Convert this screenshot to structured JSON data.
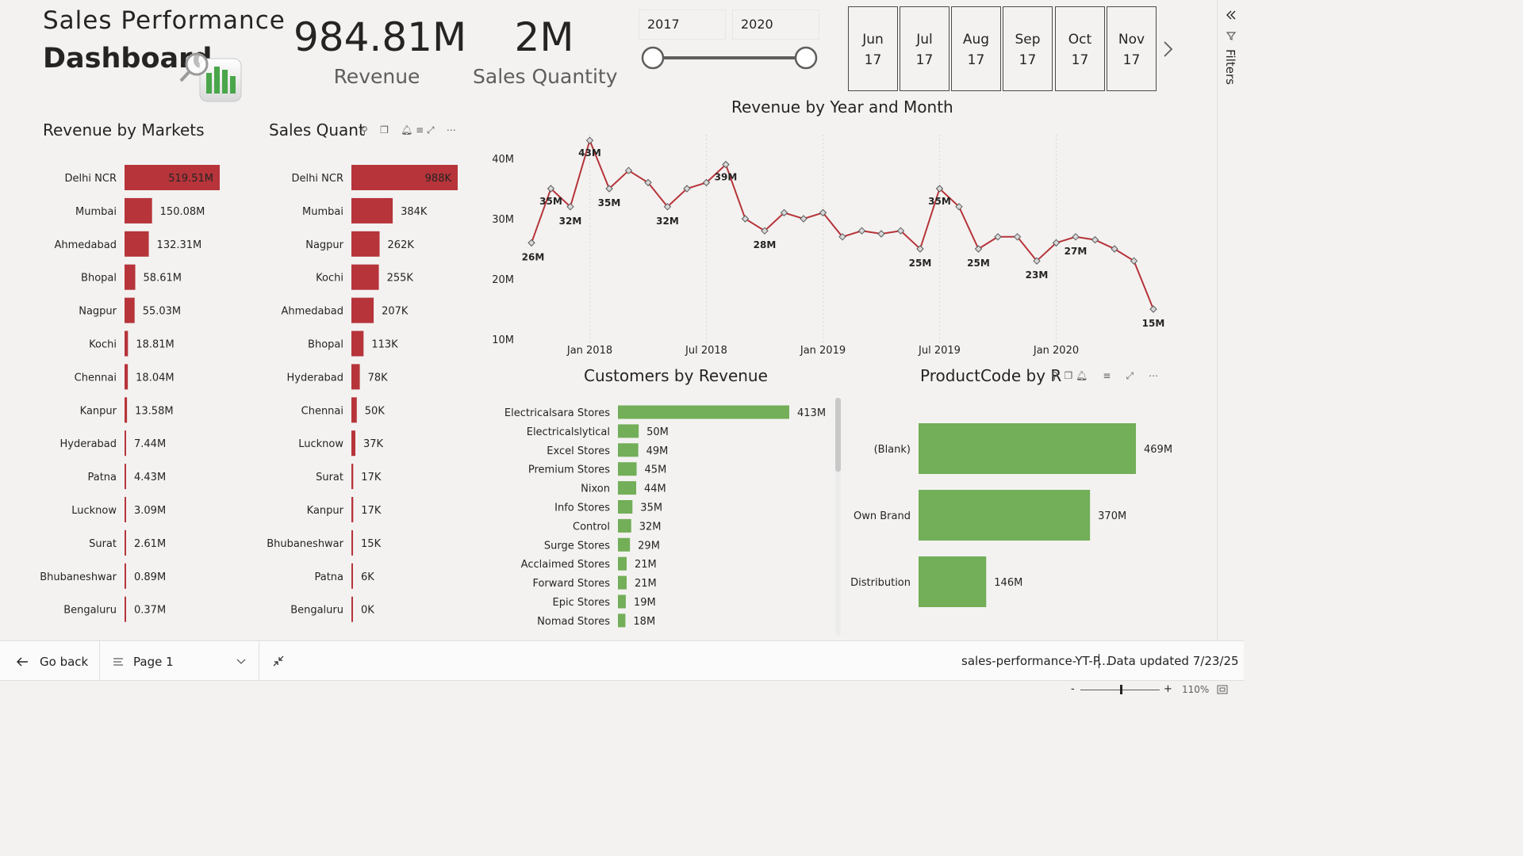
{
  "header": {
    "title_line1": "Sales  Performance",
    "title_line2": "Dashboard"
  },
  "kpis": {
    "revenue_value": "984.81M",
    "revenue_label": "Revenue",
    "quantity_value": "2M",
    "quantity_label": "Sales Quantity"
  },
  "year_slicer": {
    "from": "2017",
    "to": "2020",
    "range_fraction": [
      0.0,
      1.0
    ]
  },
  "month_tiles": [
    {
      "month": "Jun",
      "year": "17"
    },
    {
      "month": "Jul",
      "year": "17"
    },
    {
      "month": "Aug",
      "year": "17"
    },
    {
      "month": "Sep",
      "year": "17"
    },
    {
      "month": "Oct",
      "year": "17"
    },
    {
      "month": "Nov",
      "year": "17"
    }
  ],
  "filters_label": "Filters",
  "colors": {
    "red": "#b6343a",
    "green": "#73ae58",
    "line": "#b6343a"
  },
  "markets_chart": {
    "title": "Revenue by Markets",
    "chart_data": {
      "type": "bar",
      "categories": [
        "Delhi NCR",
        "Mumbai",
        "Ahmedabad",
        "Bhopal",
        "Nagpur",
        "Kochi",
        "Chennai",
        "Kanpur",
        "Hyderabad",
        "Patna",
        "Lucknow",
        "Surat",
        "Bhubaneshwar",
        "Bengaluru"
      ],
      "values": [
        519.51,
        150.08,
        132.31,
        58.61,
        55.03,
        18.81,
        18.04,
        13.58,
        7.44,
        4.43,
        3.09,
        2.61,
        0.89,
        0.37
      ],
      "labels": [
        "519.51M",
        "150.08M",
        "132.31M",
        "58.61M",
        "55.03M",
        "18.81M",
        "18.04M",
        "13.58M",
        "7.44M",
        "4.43M",
        "3.09M",
        "2.61M",
        "0.89M",
        "0.37M"
      ]
    }
  },
  "quantity_chart": {
    "title": "Sales Quant",
    "chart_data": {
      "type": "bar",
      "categories": [
        "Delhi NCR",
        "Mumbai",
        "Nagpur",
        "Kochi",
        "Ahmedabad",
        "Bhopal",
        "Hyderabad",
        "Chennai",
        "Lucknow",
        "Surat",
        "Kanpur",
        "Bhubaneshwar",
        "Patna",
        "Bengaluru"
      ],
      "values": [
        988,
        384,
        262,
        255,
        207,
        113,
        78,
        50,
        37,
        17,
        17,
        15,
        6,
        0
      ],
      "labels": [
        "988K",
        "384K",
        "262K",
        "255K",
        "207K",
        "113K",
        "78K",
        "50K",
        "37K",
        "17K",
        "17K",
        "15K",
        "6K",
        "0K"
      ]
    }
  },
  "line_chart": {
    "title": "Revenue by Year and Month",
    "chart_data": {
      "type": "line",
      "y_ticks": [
        "40M",
        "30M",
        "20M",
        "10M"
      ],
      "y_tick_values": [
        40,
        30,
        20,
        10
      ],
      "x_ticks": [
        "Jan 2018",
        "Jul 2018",
        "Jan 2019",
        "Jul 2019",
        "Jan 2020"
      ],
      "x_tick_index": [
        3,
        9,
        15,
        21,
        27
      ],
      "values": [
        26,
        35,
        32,
        43,
        35,
        38,
        36,
        32,
        35,
        36,
        39,
        30,
        28,
        31,
        30,
        31,
        27,
        28,
        27.5,
        28,
        25,
        35,
        32,
        25,
        27,
        27,
        23,
        26,
        27,
        26.5,
        25,
        23,
        15
      ],
      "point_labels": {
        "0": "26M",
        "1": "35M",
        "2": "32M",
        "3": "43M",
        "4": "35M",
        "7": "32M",
        "10": "39M",
        "12": "28M",
        "20": "25M",
        "21": "35M",
        "23": "25M",
        "26": "23M",
        "28": "27M",
        "32": "15M"
      }
    }
  },
  "customers_chart": {
    "title": "Customers by Revenue",
    "chart_data": {
      "type": "bar",
      "categories": [
        "Electricalsara Stores",
        "Electricalslytical",
        "Excel Stores",
        "Premium Stores",
        "Nixon",
        "Info Stores",
        "Control",
        "Surge Stores",
        "Acclaimed Stores",
        "Forward Stores",
        "Epic Stores",
        "Nomad Stores"
      ],
      "values": [
        413,
        50,
        49,
        45,
        44,
        35,
        32,
        29,
        21,
        21,
        19,
        18
      ],
      "labels": [
        "413M",
        "50M",
        "49M",
        "45M",
        "44M",
        "35M",
        "32M",
        "29M",
        "21M",
        "21M",
        "19M",
        "18M"
      ]
    }
  },
  "product_chart": {
    "title": "ProductCode by R",
    "chart_data": {
      "type": "bar",
      "categories": [
        "(Blank)",
        "Own Brand",
        "Distribution"
      ],
      "values": [
        469,
        370,
        146
      ],
      "labels": [
        "469M",
        "370M",
        "146M"
      ]
    }
  },
  "footer": {
    "go_back": "Go back",
    "page": "Page 1",
    "file_name": "sales-performance-YT-P...",
    "data_updated": "Data updated 7/23/25"
  },
  "status": {
    "zoom": "110%"
  }
}
